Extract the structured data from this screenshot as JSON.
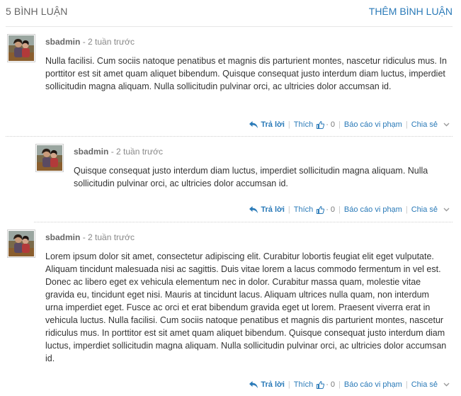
{
  "header": {
    "comment_count": "5 BÌNH LUẬN",
    "add_comment": "THÊM BÌNH LUẬN"
  },
  "comments": [
    {
      "author": "sbadmin",
      "time": "- 2 tuần trước",
      "text": "Nulla facilisi. Cum sociis natoque penatibus et magnis dis parturient montes, nascetur ridiculus mus. In porttitor est sit amet quam aliquet bibendum. Quisque consequat justo interdum diam luctus, imperdiet sollicitudin magna aliquam. Nulla sollicitudin pulvinar orci, ac ultricies dolor accumsan id.",
      "reply": "Trả lời",
      "like": "Thích",
      "like_sep": "·",
      "like_count": "0",
      "report": "Báo cáo vi phạm",
      "share": "Chia sẻ"
    },
    {
      "author": "sbadmin",
      "time": "- 2 tuần trước",
      "text": "Quisque consequat justo interdum diam luctus, imperdiet sollicitudin magna aliquam. Nulla sollicitudin pulvinar orci, ac ultricies dolor accumsan id.",
      "reply": "Trả lời",
      "like": "Thích",
      "like_sep": "·",
      "like_count": "0",
      "report": "Báo cáo vi phạm",
      "share": "Chia sẻ"
    },
    {
      "author": "sbadmin",
      "time": "- 2 tuần trước",
      "text": "Lorem ipsum dolor sit amet, consectetur adipiscing elit. Curabitur lobortis feugiat elit eget vulputate. Aliquam tincidunt malesuada nisi ac sagittis. Duis vitae lorem a lacus commodo fermentum in vel est. Donec ac libero eget ex vehicula elementum nec in dolor. Curabitur massa quam, molestie vitae gravida eu, tincidunt eget nisi. Mauris at tincidunt lacus. Aliquam ultrices nulla quam, non interdum urna imperdiet eget. Fusce ac orci et erat bibendum gravida eget ut lorem. Praesent viverra erat in vehicula luctus. Nulla facilisi. Cum sociis natoque penatibus et magnis dis parturient montes, nascetur ridiculus mus. In porttitor est sit amet quam aliquet bibendum. Quisque consequat justo interdum diam luctus, imperdiet sollicitudin magna aliquam. Nulla sollicitudin pulvinar orci, ac ultricies dolor accumsan id.",
      "reply": "Trả lời",
      "like": "Thích",
      "like_sep": "·",
      "like_count": "0",
      "report": "Báo cáo vi phạm",
      "share": "Chia sẻ"
    }
  ],
  "colors": {
    "link": "#2a7ab8",
    "text": "#333333",
    "muted": "#888888",
    "divider": "#e6e6e6"
  },
  "icons": {
    "reply": "reply-arrow-icon",
    "like": "thumbs-up-icon",
    "share_menu": "chevron-down-icon",
    "avatar": "user-photo-avatar"
  }
}
